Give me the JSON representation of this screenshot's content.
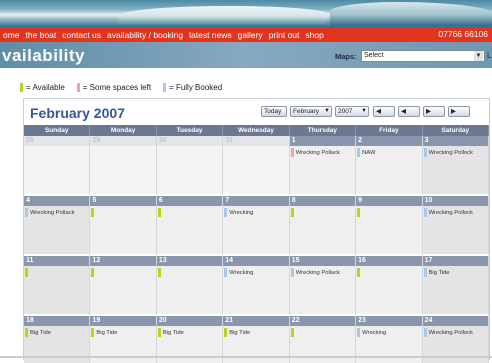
{
  "nav": {
    "items": [
      "ome",
      "the boat",
      "contact us",
      "availability / booking",
      "latest news",
      "gallery",
      "print out",
      "shop"
    ],
    "phone": "07766 66106"
  },
  "page": {
    "title": "vailability"
  },
  "maps": {
    "label": "Maps:",
    "selected": "Select",
    "edge": "L"
  },
  "legend": {
    "available": "= Available",
    "some": "= Some spaces left",
    "booked": "= Fully Booked"
  },
  "calendar": {
    "month_label": "February 2007",
    "month_select": "February",
    "year_select": "2007",
    "today_button": "Today",
    "weekdays": [
      "Sunday",
      "Monday",
      "Tuesday",
      "Wednesday",
      "Thursday",
      "Friday",
      "Saturday"
    ],
    "days": [
      {
        "n": "28",
        "out": true,
        "ev": []
      },
      {
        "n": "29",
        "out": true,
        "ev": []
      },
      {
        "n": "30",
        "out": true,
        "ev": []
      },
      {
        "n": "31",
        "out": true,
        "ev": []
      },
      {
        "n": "1",
        "ev": [
          {
            "t": "Wrecking Pollack",
            "s": "some"
          }
        ]
      },
      {
        "n": "2",
        "ev": [
          {
            "t": "NAW",
            "s": "booked"
          }
        ]
      },
      {
        "n": "3",
        "ev": [
          {
            "t": "Wrecking Pollock",
            "s": "booked"
          }
        ]
      },
      {
        "n": "4",
        "ev": [
          {
            "t": "Wrecking Pollack",
            "s": "booked"
          }
        ]
      },
      {
        "n": "5",
        "ev": [
          {
            "t": "",
            "s": "available"
          }
        ]
      },
      {
        "n": "6",
        "ev": [
          {
            "t": "",
            "s": "available"
          }
        ]
      },
      {
        "n": "7",
        "ev": [
          {
            "t": "Wrecking",
            "s": "booked"
          }
        ]
      },
      {
        "n": "8",
        "ev": [
          {
            "t": "",
            "s": "available"
          }
        ]
      },
      {
        "n": "9",
        "ev": [
          {
            "t": "",
            "s": "available"
          }
        ]
      },
      {
        "n": "10",
        "ev": [
          {
            "t": "Wrecking Pollock",
            "s": "booked"
          }
        ]
      },
      {
        "n": "11",
        "ev": [
          {
            "t": "",
            "s": "available"
          }
        ]
      },
      {
        "n": "12",
        "ev": [
          {
            "t": "",
            "s": "available"
          }
        ]
      },
      {
        "n": "13",
        "ev": [
          {
            "t": "",
            "s": "available"
          }
        ]
      },
      {
        "n": "14",
        "ev": [
          {
            "t": "Wrecking",
            "s": "booked"
          }
        ]
      },
      {
        "n": "15",
        "ev": [
          {
            "t": "Wrecking Pollack",
            "s": "booked"
          }
        ]
      },
      {
        "n": "16",
        "ev": [
          {
            "t": "",
            "s": "available"
          }
        ]
      },
      {
        "n": "17",
        "ev": [
          {
            "t": "Big Tide",
            "s": "booked"
          }
        ]
      },
      {
        "n": "18",
        "ev": [
          {
            "t": "Big Tide",
            "s": "available"
          }
        ]
      },
      {
        "n": "19",
        "ev": [
          {
            "t": "Big Tide",
            "s": "available"
          }
        ]
      },
      {
        "n": "20",
        "ev": [
          {
            "t": "Big Tide",
            "s": "available"
          }
        ]
      },
      {
        "n": "21",
        "ev": [
          {
            "t": "Big Tide",
            "s": "available"
          }
        ]
      },
      {
        "n": "22",
        "ev": [
          {
            "t": "",
            "s": "available"
          }
        ]
      },
      {
        "n": "23",
        "ev": [
          {
            "t": "Wrecking",
            "s": "booked"
          }
        ]
      },
      {
        "n": "24",
        "ev": [
          {
            "t": "Wrecking Pollock",
            "s": "booked"
          }
        ]
      }
    ]
  },
  "colors": {
    "available": "#b8d41c",
    "some": "#f2a3a8",
    "booked": "#a8c8e8",
    "nav_red": "#e2351f"
  },
  "icons": {
    "select_arrow": "chevron-down-icon",
    "prev_arrow": "arrow-left-icon",
    "next_arrow": "arrow-right-icon"
  }
}
